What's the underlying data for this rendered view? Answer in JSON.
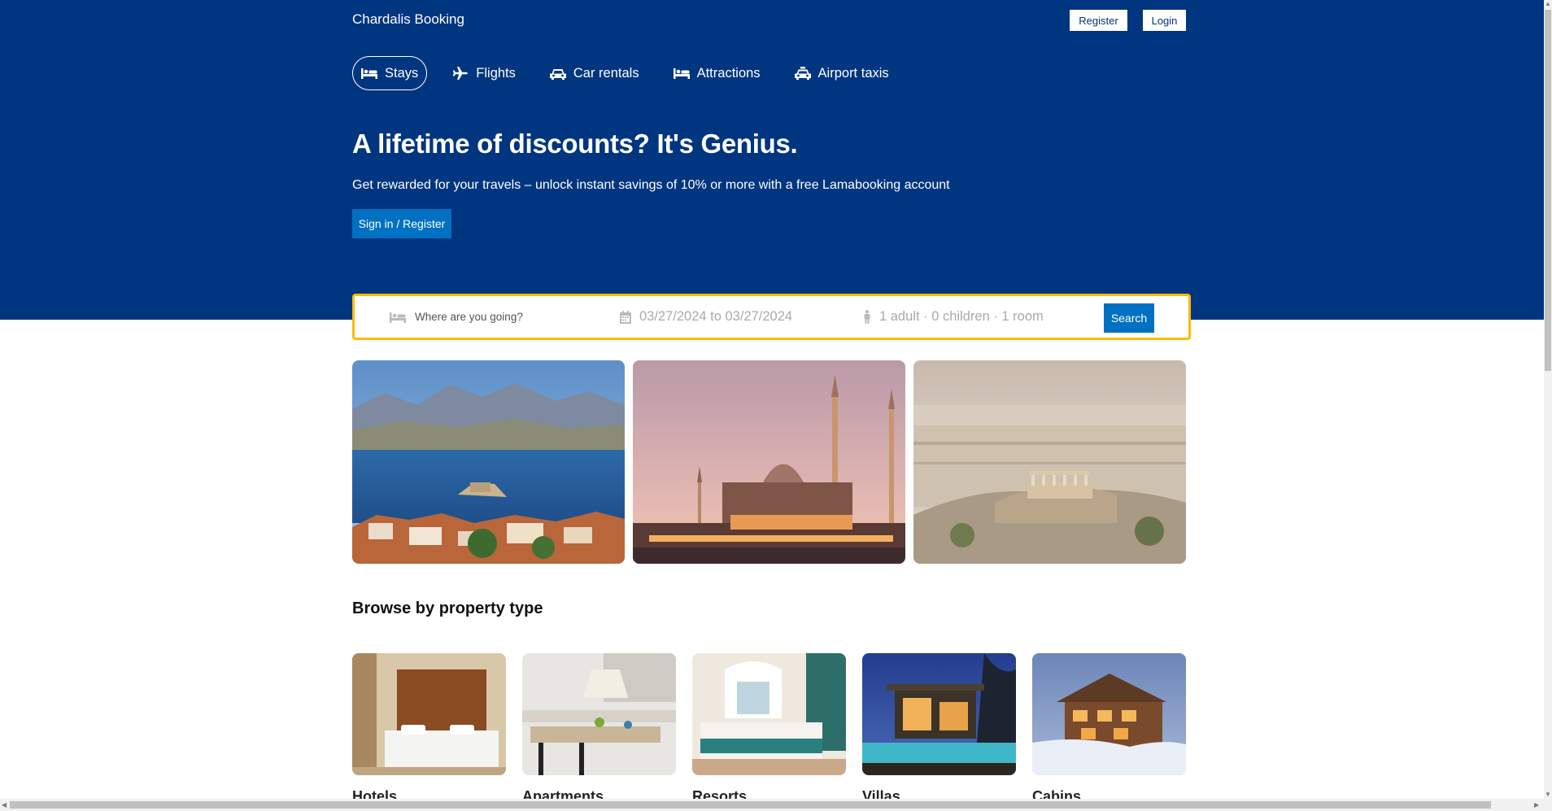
{
  "brand": "Chardalis Booking",
  "header": {
    "register_label": "Register",
    "login_label": "Login"
  },
  "nav": [
    {
      "label": "Stays",
      "icon": "bed-icon",
      "active": true
    },
    {
      "label": "Flights",
      "icon": "plane-icon",
      "active": false
    },
    {
      "label": "Car rentals",
      "icon": "car-icon",
      "active": false
    },
    {
      "label": "Attractions",
      "icon": "bed-icon",
      "active": false
    },
    {
      "label": "Airport taxis",
      "icon": "taxi-icon",
      "active": false
    }
  ],
  "hero": {
    "title": "A lifetime of discounts? It's Genius.",
    "subtitle": "Get rewarded for your travels – unlock instant savings of 10% or more with a free Lamabooking account",
    "button_label": "Sign in / Register"
  },
  "search": {
    "destination_placeholder": "Where are you going?",
    "dates": "03/27/2024 to 03/27/2024",
    "guests": "1 adult · 0 children · 1 room",
    "button_label": "Search"
  },
  "featured": [
    {
      "alt": "Nafplio coastal town"
    },
    {
      "alt": "Istanbul mosque at sunset"
    },
    {
      "alt": "Athens Acropolis"
    }
  ],
  "property_section_title": "Browse by property type",
  "property_types": [
    {
      "label": "Hotels"
    },
    {
      "label": "Apartments"
    },
    {
      "label": "Resorts"
    },
    {
      "label": "Villas"
    },
    {
      "label": "Cabins"
    }
  ],
  "colors": {
    "brand_blue": "#003580",
    "action_blue": "#0071c2",
    "search_border": "#febb02"
  }
}
